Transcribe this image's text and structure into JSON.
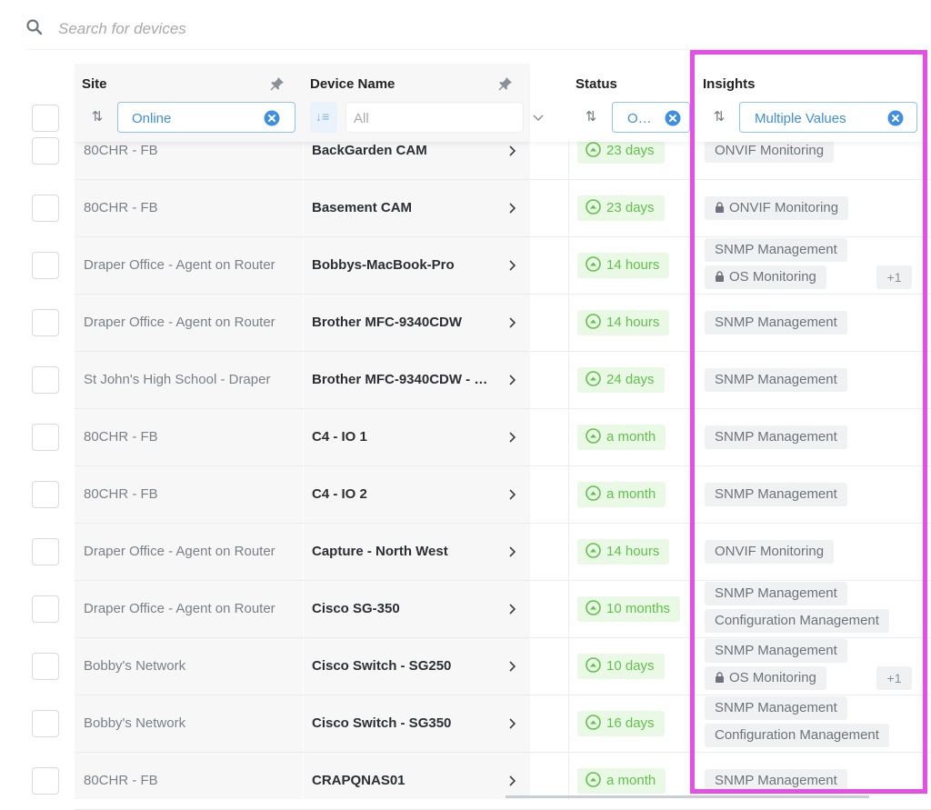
{
  "search": {
    "placeholder": "Search for devices",
    "value": ""
  },
  "columns": {
    "site": {
      "title": "Site",
      "filter": "Online"
    },
    "device": {
      "title": "Device Name",
      "filter_placeholder": "All"
    },
    "status": {
      "title": "Status",
      "filter": "O…"
    },
    "insights": {
      "title": "Insights",
      "filter": "Multiple Values"
    }
  },
  "colors": {
    "highlight": "#e84de8",
    "accent": "#3e8fe0",
    "status_green": "#62c04d"
  },
  "rows": [
    {
      "site": "80CHR - FB",
      "device": "BackGarden CAM",
      "status": "23 days",
      "insights": [
        "ONVIF Monitoring"
      ],
      "locked": [
        false
      ],
      "more": ""
    },
    {
      "site": "80CHR - FB",
      "device": "Basement CAM",
      "status": "23 days",
      "insights": [
        "ONVIF Monitoring"
      ],
      "locked": [
        true
      ],
      "more": ""
    },
    {
      "site": "Draper Office - Agent on Router",
      "device": "Bobbys-MacBook-Pro",
      "status": "14 hours",
      "insights": [
        "SNMP Management",
        "OS Monitoring"
      ],
      "locked": [
        false,
        true
      ],
      "more": "+1"
    },
    {
      "site": "Draper Office - Agent on Router",
      "device": "Brother MFC-9340CDW",
      "status": "14 hours",
      "insights": [
        "SNMP Management"
      ],
      "locked": [
        false
      ],
      "more": ""
    },
    {
      "site": "St John's High School - Draper",
      "device": "Brother MFC-9340CDW - …",
      "status": "24 days",
      "insights": [
        "SNMP Management"
      ],
      "locked": [
        false
      ],
      "more": ""
    },
    {
      "site": "80CHR - FB",
      "device": "C4 - IO 1",
      "status": "a month",
      "insights": [
        "SNMP Management"
      ],
      "locked": [
        false
      ],
      "more": ""
    },
    {
      "site": "80CHR - FB",
      "device": "C4 - IO 2",
      "status": "a month",
      "insights": [
        "SNMP Management"
      ],
      "locked": [
        false
      ],
      "more": ""
    },
    {
      "site": "Draper Office - Agent on Router",
      "device": "Capture - North West",
      "status": "14 hours",
      "insights": [
        "ONVIF Monitoring"
      ],
      "locked": [
        false
      ],
      "more": ""
    },
    {
      "site": "Draper Office - Agent on Router",
      "device": "Cisco SG-350",
      "status": "10 months",
      "insights": [
        "SNMP Management",
        "Configuration Management"
      ],
      "locked": [
        false,
        false
      ],
      "more": ""
    },
    {
      "site": "Bobby's Network",
      "device": "Cisco Switch - SG250",
      "status": "10 days",
      "insights": [
        "SNMP Management",
        "OS Monitoring"
      ],
      "locked": [
        false,
        true
      ],
      "more": "+1"
    },
    {
      "site": "Bobby's Network",
      "device": "Cisco Switch - SG350",
      "status": "16 days",
      "insights": [
        "SNMP Management",
        "Configuration Management"
      ],
      "locked": [
        false,
        false
      ],
      "more": ""
    },
    {
      "site": "80CHR - FB",
      "device": "CRAPQNAS01",
      "status": "a month",
      "insights": [
        "SNMP Management"
      ],
      "locked": [
        false
      ],
      "more": ""
    }
  ]
}
